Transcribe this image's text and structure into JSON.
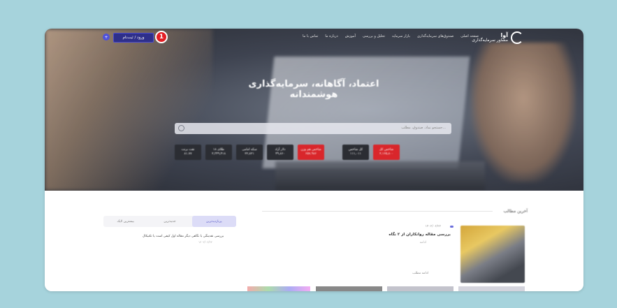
{
  "nav": {
    "logo_title": "آوا",
    "logo_subtitle": "مشاور سرمایه‌گذاری",
    "menu": [
      "صفحه اصلی",
      "صندوق‌های سرمایه‌گذاری",
      "بازار سرمایه",
      "تحلیل و بررسی",
      "آموزش",
      "درباره ما",
      "تماس با ما"
    ],
    "login_label": "ورود / ثبت‌نام",
    "step_badge": "1",
    "user_icon": "+"
  },
  "hero": {
    "headline": "اعتماد، آگاهانه، سرمایه‌گذاری هوشمندانه",
    "search_placeholder": "جستجو نماد، صندوق، مطلب...",
    "chips": [
      {
        "line1": "شاخص کل",
        "line2": "۲,۱۶۵,۸۰۰",
        "style": "red"
      },
      {
        "line1": "کل شاخص",
        "line2": "۱۱۱,۰۱۱",
        "style": "dark"
      },
      {
        "line1": "",
        "line2": "",
        "style": "plain"
      },
      {
        "line1": "شاخص هم وزن",
        "line2": "۶۵۷,۹۸۶",
        "style": "red"
      },
      {
        "line1": "دلار آزاد",
        "line2": "۴۹,۸۶۰",
        "style": "dark"
      },
      {
        "line1": "سکه امامی",
        "line2": "۲۲,۸۲۱",
        "style": "dark"
      },
      {
        "line1": "طلای ۱۸",
        "line2": "۲,۳۴۹,۴۱۸",
        "style": "dark"
      },
      {
        "line1": "نفت برنت",
        "line2": "۸۱.۷۷",
        "style": "dark"
      }
    ]
  },
  "content": {
    "section_title": "آخرین مطالب",
    "article_meta": "۱۴۰۲/۰۶/۲۲",
    "article_title": "بررسی مقاله روانکاران از ۲ نگاه",
    "article_sub": "ادامه",
    "article_more": "ادامه مطلب",
    "tabs": [
      "پربازدیدترین",
      "جدیدترین",
      "بیشترین لایک"
    ],
    "side_item": "بررسی نقدینگی با نگاهی دیگر مقاله اول کیفی است یا تکنیکال",
    "side_sub": "۱۴۰۲/۰۶/۲۲"
  }
}
